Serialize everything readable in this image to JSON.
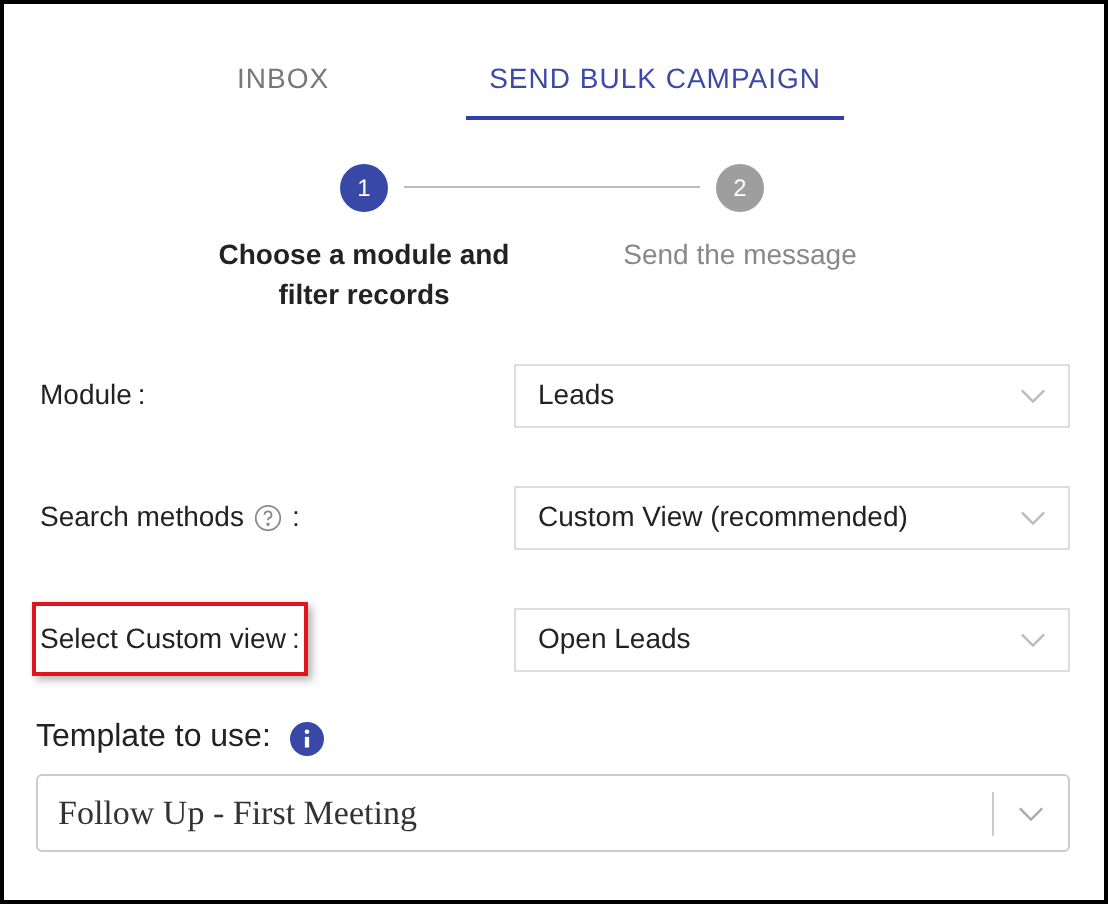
{
  "tabs": [
    {
      "label": "INBOX",
      "selected": false
    },
    {
      "label": "SEND BULK CAMPAIGN",
      "selected": true
    }
  ],
  "steps": [
    {
      "number": "1",
      "label": "Choose a module and filter records",
      "selected": true
    },
    {
      "number": "2",
      "label": "Send the message",
      "selected": false
    }
  ],
  "fields": [
    {
      "label": "Module",
      "help": false,
      "suffix": ":",
      "value": "Leads",
      "highlighted": false
    },
    {
      "label": "Search methods",
      "help": true,
      "suffix": ":",
      "value": "Custom View (recommended)",
      "highlighted": false
    },
    {
      "label": "Select Custom view",
      "help": false,
      "suffix": ":",
      "value": "Open Leads",
      "highlighted": true
    }
  ],
  "template": {
    "label": "Template to use:",
    "info": true,
    "value": "Follow Up - First Meeting"
  }
}
